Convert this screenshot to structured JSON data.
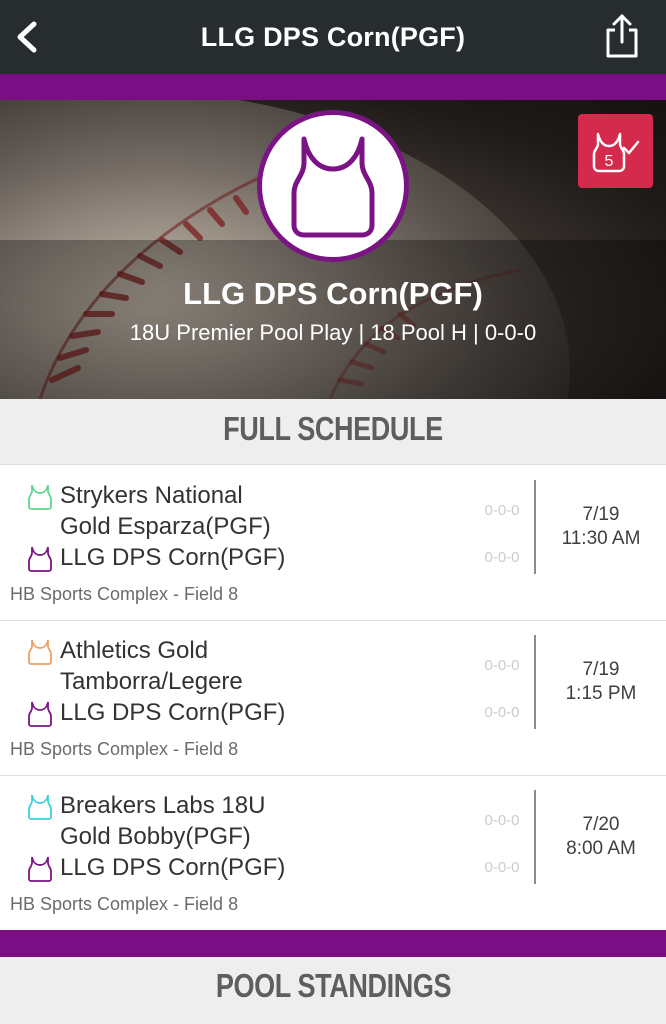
{
  "nav": {
    "title": "LLG DPS Corn(PGF)"
  },
  "hero": {
    "team_name": "LLG DPS Corn(PGF)",
    "subtitle": "18U Premier Pool Play | 18 Pool H | 0-0-0",
    "badge_number": "5"
  },
  "sections": {
    "full_schedule": "FULL SCHEDULE",
    "pool_standings": "POOL STANDINGS"
  },
  "games": [
    {
      "away_line1": "Strykers National",
      "away_line2": "Gold Esparza(PGF)",
      "away_record": "0-0-0",
      "home": "LLG DPS Corn(PGF)",
      "home_record": "0-0-0",
      "date": "7/19",
      "time": "11:30 AM",
      "venue": "HB Sports Complex - Field 8"
    },
    {
      "away_line1": "Athletics Gold",
      "away_line2": "Tamborra/Legere",
      "away_record": "0-0-0",
      "home": "LLG DPS Corn(PGF)",
      "home_record": "0-0-0",
      "date": "7/19",
      "time": "1:15 PM",
      "venue": "HB Sports Complex - Field 8"
    },
    {
      "away_line1": "Breakers Labs 18U",
      "away_line2": "Gold Bobby(PGF)",
      "away_record": "0-0-0",
      "home": "LLG DPS Corn(PGF)",
      "home_record": "0-0-0",
      "date": "7/20",
      "time": "8:00 AM",
      "venue": "HB Sports Complex - Field 8"
    }
  ],
  "icons": {
    "back": "chevron-left-icon",
    "share": "share-icon",
    "team_logo": "jersey-icon",
    "badge": "jersey-check-icon"
  },
  "colors": {
    "nav_bg": "#272c2f",
    "brand_purple": "#7a0f85",
    "badge_red": "#d42a4c",
    "jersey_green": "#5fd68e",
    "jersey_orange": "#f0a060",
    "jersey_cyan": "#3fd0e0",
    "jersey_purple": "#7a1485"
  }
}
